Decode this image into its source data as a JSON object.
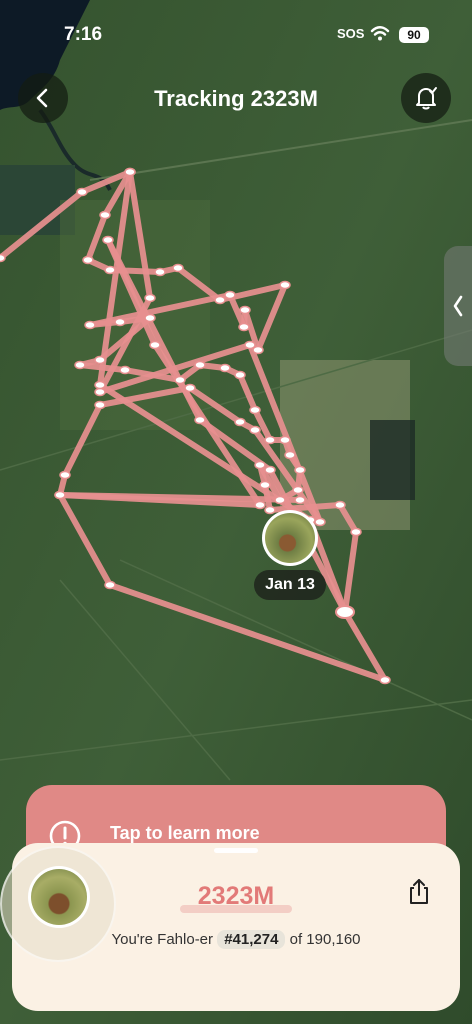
{
  "status": {
    "time": "7:16",
    "sos": "SOS",
    "battery": "90"
  },
  "header": {
    "title": "Tracking 2323M",
    "back_icon": "chevron-left-icon",
    "alert_icon": "bell-check-icon"
  },
  "map": {
    "current_date_label": "Jan 13",
    "track_color": "#e89090",
    "land_color": "#3d5b36"
  },
  "learn_banner": {
    "text": "Tap to learn more",
    "icon": "info-icon"
  },
  "sheet": {
    "distance": "2323M",
    "rank_prefix": "You're Fahlo-er",
    "rank_value": "#41,274",
    "rank_total": "of 190,160",
    "share_icon": "share-icon"
  },
  "colors": {
    "accent": "#e08986",
    "sheet_bg": "#fbf1e4",
    "distance_text": "#e27a78"
  }
}
